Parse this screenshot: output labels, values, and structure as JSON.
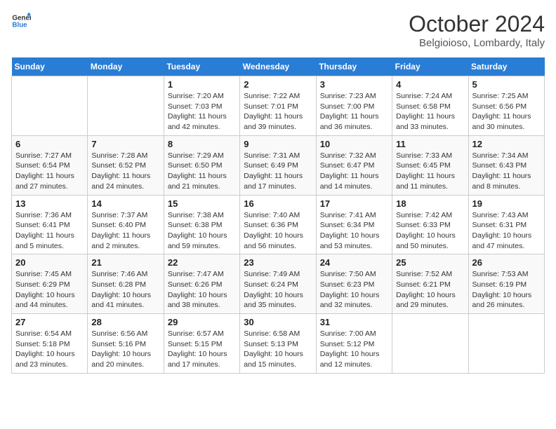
{
  "logo": {
    "line1": "General",
    "line2": "Blue"
  },
  "title": "October 2024",
  "location": "Belgioioso, Lombardy, Italy",
  "weekdays": [
    "Sunday",
    "Monday",
    "Tuesday",
    "Wednesday",
    "Thursday",
    "Friday",
    "Saturday"
  ],
  "weeks": [
    [
      {
        "day": "",
        "sunrise": "",
        "sunset": "",
        "daylight": ""
      },
      {
        "day": "",
        "sunrise": "",
        "sunset": "",
        "daylight": ""
      },
      {
        "day": "1",
        "sunrise": "Sunrise: 7:20 AM",
        "sunset": "Sunset: 7:03 PM",
        "daylight": "Daylight: 11 hours and 42 minutes."
      },
      {
        "day": "2",
        "sunrise": "Sunrise: 7:22 AM",
        "sunset": "Sunset: 7:01 PM",
        "daylight": "Daylight: 11 hours and 39 minutes."
      },
      {
        "day": "3",
        "sunrise": "Sunrise: 7:23 AM",
        "sunset": "Sunset: 7:00 PM",
        "daylight": "Daylight: 11 hours and 36 minutes."
      },
      {
        "day": "4",
        "sunrise": "Sunrise: 7:24 AM",
        "sunset": "Sunset: 6:58 PM",
        "daylight": "Daylight: 11 hours and 33 minutes."
      },
      {
        "day": "5",
        "sunrise": "Sunrise: 7:25 AM",
        "sunset": "Sunset: 6:56 PM",
        "daylight": "Daylight: 11 hours and 30 minutes."
      }
    ],
    [
      {
        "day": "6",
        "sunrise": "Sunrise: 7:27 AM",
        "sunset": "Sunset: 6:54 PM",
        "daylight": "Daylight: 11 hours and 27 minutes."
      },
      {
        "day": "7",
        "sunrise": "Sunrise: 7:28 AM",
        "sunset": "Sunset: 6:52 PM",
        "daylight": "Daylight: 11 hours and 24 minutes."
      },
      {
        "day": "8",
        "sunrise": "Sunrise: 7:29 AM",
        "sunset": "Sunset: 6:50 PM",
        "daylight": "Daylight: 11 hours and 21 minutes."
      },
      {
        "day": "9",
        "sunrise": "Sunrise: 7:31 AM",
        "sunset": "Sunset: 6:49 PM",
        "daylight": "Daylight: 11 hours and 17 minutes."
      },
      {
        "day": "10",
        "sunrise": "Sunrise: 7:32 AM",
        "sunset": "Sunset: 6:47 PM",
        "daylight": "Daylight: 11 hours and 14 minutes."
      },
      {
        "day": "11",
        "sunrise": "Sunrise: 7:33 AM",
        "sunset": "Sunset: 6:45 PM",
        "daylight": "Daylight: 11 hours and 11 minutes."
      },
      {
        "day": "12",
        "sunrise": "Sunrise: 7:34 AM",
        "sunset": "Sunset: 6:43 PM",
        "daylight": "Daylight: 11 hours and 8 minutes."
      }
    ],
    [
      {
        "day": "13",
        "sunrise": "Sunrise: 7:36 AM",
        "sunset": "Sunset: 6:41 PM",
        "daylight": "Daylight: 11 hours and 5 minutes."
      },
      {
        "day": "14",
        "sunrise": "Sunrise: 7:37 AM",
        "sunset": "Sunset: 6:40 PM",
        "daylight": "Daylight: 11 hours and 2 minutes."
      },
      {
        "day": "15",
        "sunrise": "Sunrise: 7:38 AM",
        "sunset": "Sunset: 6:38 PM",
        "daylight": "Daylight: 10 hours and 59 minutes."
      },
      {
        "day": "16",
        "sunrise": "Sunrise: 7:40 AM",
        "sunset": "Sunset: 6:36 PM",
        "daylight": "Daylight: 10 hours and 56 minutes."
      },
      {
        "day": "17",
        "sunrise": "Sunrise: 7:41 AM",
        "sunset": "Sunset: 6:34 PM",
        "daylight": "Daylight: 10 hours and 53 minutes."
      },
      {
        "day": "18",
        "sunrise": "Sunrise: 7:42 AM",
        "sunset": "Sunset: 6:33 PM",
        "daylight": "Daylight: 10 hours and 50 minutes."
      },
      {
        "day": "19",
        "sunrise": "Sunrise: 7:43 AM",
        "sunset": "Sunset: 6:31 PM",
        "daylight": "Daylight: 10 hours and 47 minutes."
      }
    ],
    [
      {
        "day": "20",
        "sunrise": "Sunrise: 7:45 AM",
        "sunset": "Sunset: 6:29 PM",
        "daylight": "Daylight: 10 hours and 44 minutes."
      },
      {
        "day": "21",
        "sunrise": "Sunrise: 7:46 AM",
        "sunset": "Sunset: 6:28 PM",
        "daylight": "Daylight: 10 hours and 41 minutes."
      },
      {
        "day": "22",
        "sunrise": "Sunrise: 7:47 AM",
        "sunset": "Sunset: 6:26 PM",
        "daylight": "Daylight: 10 hours and 38 minutes."
      },
      {
        "day": "23",
        "sunrise": "Sunrise: 7:49 AM",
        "sunset": "Sunset: 6:24 PM",
        "daylight": "Daylight: 10 hours and 35 minutes."
      },
      {
        "day": "24",
        "sunrise": "Sunrise: 7:50 AM",
        "sunset": "Sunset: 6:23 PM",
        "daylight": "Daylight: 10 hours and 32 minutes."
      },
      {
        "day": "25",
        "sunrise": "Sunrise: 7:52 AM",
        "sunset": "Sunset: 6:21 PM",
        "daylight": "Daylight: 10 hours and 29 minutes."
      },
      {
        "day": "26",
        "sunrise": "Sunrise: 7:53 AM",
        "sunset": "Sunset: 6:19 PM",
        "daylight": "Daylight: 10 hours and 26 minutes."
      }
    ],
    [
      {
        "day": "27",
        "sunrise": "Sunrise: 6:54 AM",
        "sunset": "Sunset: 5:18 PM",
        "daylight": "Daylight: 10 hours and 23 minutes."
      },
      {
        "day": "28",
        "sunrise": "Sunrise: 6:56 AM",
        "sunset": "Sunset: 5:16 PM",
        "daylight": "Daylight: 10 hours and 20 minutes."
      },
      {
        "day": "29",
        "sunrise": "Sunrise: 6:57 AM",
        "sunset": "Sunset: 5:15 PM",
        "daylight": "Daylight: 10 hours and 17 minutes."
      },
      {
        "day": "30",
        "sunrise": "Sunrise: 6:58 AM",
        "sunset": "Sunset: 5:13 PM",
        "daylight": "Daylight: 10 hours and 15 minutes."
      },
      {
        "day": "31",
        "sunrise": "Sunrise: 7:00 AM",
        "sunset": "Sunset: 5:12 PM",
        "daylight": "Daylight: 10 hours and 12 minutes."
      },
      {
        "day": "",
        "sunrise": "",
        "sunset": "",
        "daylight": ""
      },
      {
        "day": "",
        "sunrise": "",
        "sunset": "",
        "daylight": ""
      }
    ]
  ]
}
